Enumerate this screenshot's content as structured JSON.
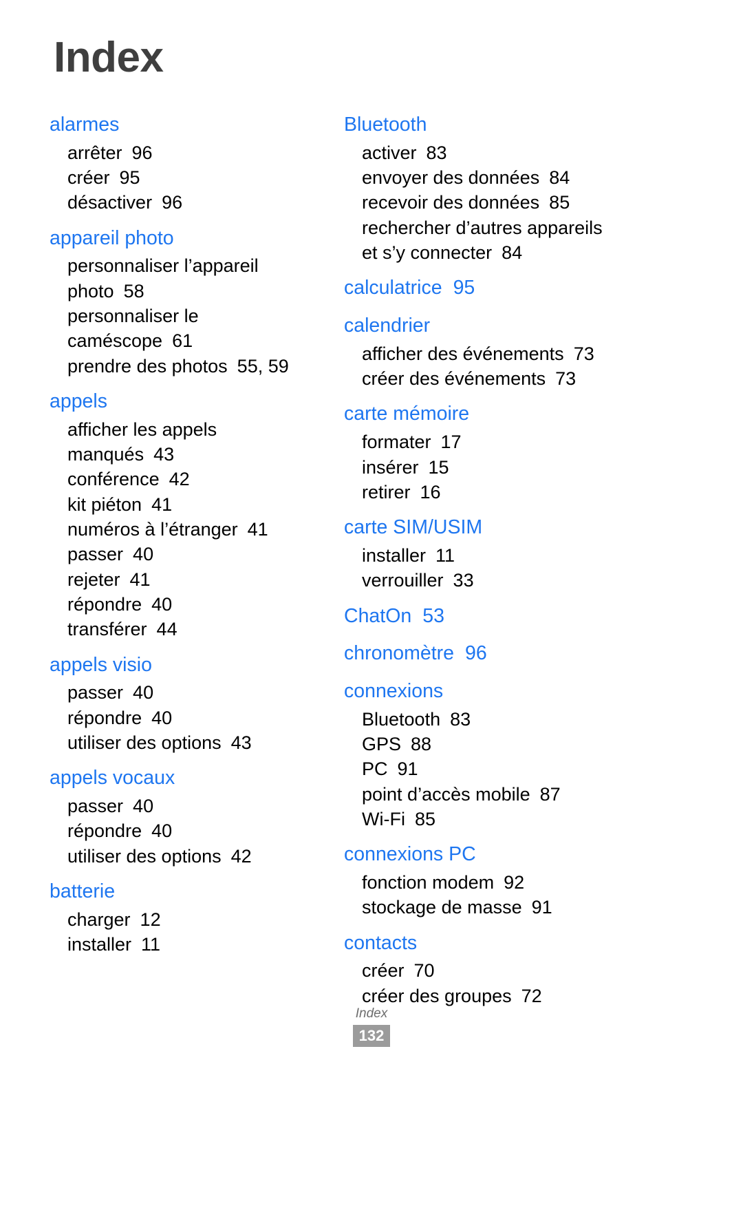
{
  "page": {
    "title": "Index",
    "accent_color": "#1e76f0",
    "title_color": "#3f3f3f",
    "body_color": "#000000"
  },
  "footer": {
    "label": "Index",
    "page_number": "132",
    "badge_color": "#9b9b9b"
  },
  "columns": [
    {
      "entries": [
        {
          "term": "alarmes",
          "term_page": "",
          "subitems": [
            {
              "label": "arrêter",
              "page": "96"
            },
            {
              "label": "créer",
              "page": "95"
            },
            {
              "label": "désactiver",
              "page": "96"
            }
          ]
        },
        {
          "term": "appareil photo",
          "term_page": "",
          "subitems": [
            {
              "label": "personnaliser l’appareil\nphoto",
              "page": "58"
            },
            {
              "label": "personnaliser le\ncaméscope",
              "page": "61"
            },
            {
              "label": "prendre des photos",
              "page": "55, 59"
            }
          ]
        },
        {
          "term": "appels",
          "term_page": "",
          "subitems": [
            {
              "label": "afficher les appels\nmanqués",
              "page": "43"
            },
            {
              "label": "conférence",
              "page": "42"
            },
            {
              "label": "kit piéton",
              "page": "41"
            },
            {
              "label": "numéros à l’étranger",
              "page": "41"
            },
            {
              "label": "passer",
              "page": "40"
            },
            {
              "label": "rejeter",
              "page": "41"
            },
            {
              "label": "répondre",
              "page": "40"
            },
            {
              "label": "transférer",
              "page": "44"
            }
          ]
        },
        {
          "term": "appels visio",
          "term_page": "",
          "subitems": [
            {
              "label": "passer",
              "page": "40"
            },
            {
              "label": "répondre",
              "page": "40"
            },
            {
              "label": "utiliser des options",
              "page": "43"
            }
          ]
        },
        {
          "term": "appels vocaux",
          "term_page": "",
          "subitems": [
            {
              "label": "passer",
              "page": "40"
            },
            {
              "label": "répondre",
              "page": "40"
            },
            {
              "label": "utiliser des options",
              "page": "42"
            }
          ]
        },
        {
          "term": "batterie",
          "term_page": "",
          "subitems": [
            {
              "label": "charger",
              "page": "12"
            },
            {
              "label": "installer",
              "page": "11"
            }
          ]
        }
      ]
    },
    {
      "entries": [
        {
          "term": "Bluetooth",
          "term_page": "",
          "subitems": [
            {
              "label": "activer",
              "page": "83"
            },
            {
              "label": "envoyer des données",
              "page": "84"
            },
            {
              "label": "recevoir des données",
              "page": "85"
            },
            {
              "label": "rechercher d’autres appareils\net s’y connecter",
              "page": "84"
            }
          ]
        },
        {
          "term": "calculatrice",
          "term_page": "95",
          "subitems": []
        },
        {
          "term": "calendrier",
          "term_page": "",
          "subitems": [
            {
              "label": "afficher des événements",
              "page": "73"
            },
            {
              "label": "créer des événements",
              "page": "73"
            }
          ]
        },
        {
          "term": "carte mémoire",
          "term_page": "",
          "subitems": [
            {
              "label": "formater",
              "page": "17"
            },
            {
              "label": "insérer",
              "page": "15"
            },
            {
              "label": "retirer",
              "page": "16"
            }
          ]
        },
        {
          "term": "carte SIM/USIM",
          "term_page": "",
          "subitems": [
            {
              "label": "installer",
              "page": "11"
            },
            {
              "label": "verrouiller",
              "page": "33"
            }
          ]
        },
        {
          "term": "ChatOn",
          "term_page": "53",
          "subitems": []
        },
        {
          "term": "chronomètre",
          "term_page": "96",
          "subitems": []
        },
        {
          "term": "connexions",
          "term_page": "",
          "subitems": [
            {
              "label": "Bluetooth",
              "page": "83"
            },
            {
              "label": "GPS",
              "page": "88"
            },
            {
              "label": "PC",
              "page": "91"
            },
            {
              "label": "point d’accès mobile",
              "page": "87"
            },
            {
              "label": "Wi-Fi",
              "page": "85"
            }
          ]
        },
        {
          "term": "connexions PC",
          "term_page": "",
          "subitems": [
            {
              "label": "fonction modem",
              "page": "92"
            },
            {
              "label": "stockage de masse",
              "page": "91"
            }
          ]
        },
        {
          "term": "contacts",
          "term_page": "",
          "subitems": [
            {
              "label": "créer",
              "page": "70"
            },
            {
              "label": "créer des groupes",
              "page": "72"
            }
          ]
        }
      ]
    }
  ]
}
